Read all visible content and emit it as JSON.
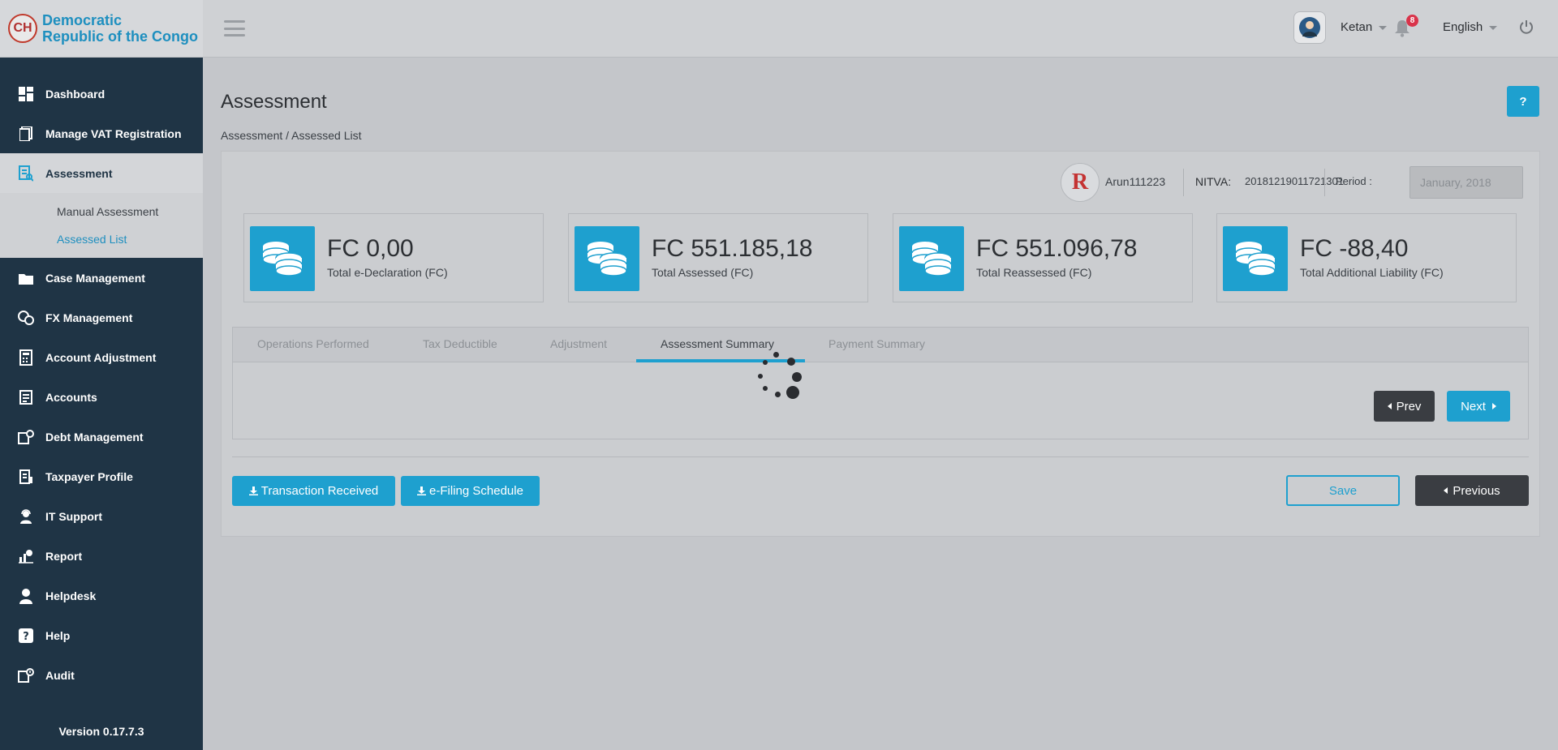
{
  "brand": {
    "name_line1": "Democratic",
    "name_line2": "Republic of the Congo",
    "logo_text": "CH"
  },
  "sidebar": {
    "items": [
      {
        "label": "Dashboard",
        "icon": "dashboard-icon"
      },
      {
        "label": "Manage VAT Registration",
        "icon": "vat-registration-icon"
      },
      {
        "label": "Assessment",
        "icon": "assessment-icon"
      },
      {
        "label": "Case Management",
        "icon": "case-management-icon"
      },
      {
        "label": "FX Management",
        "icon": "fx-management-icon"
      },
      {
        "label": "Account Adjustment",
        "icon": "account-adjustment-icon"
      },
      {
        "label": "Accounts",
        "icon": "accounts-icon"
      },
      {
        "label": "Debt Management",
        "icon": "debt-management-icon"
      },
      {
        "label": "Taxpayer Profile",
        "icon": "taxpayer-profile-icon"
      },
      {
        "label": "IT Support",
        "icon": "it-support-icon"
      },
      {
        "label": "Report",
        "icon": "report-icon"
      },
      {
        "label": "Helpdesk",
        "icon": "helpdesk-icon"
      },
      {
        "label": "Help",
        "icon": "help-icon"
      },
      {
        "label": "Audit",
        "icon": "audit-icon"
      }
    ],
    "submenu": [
      {
        "label": "Manual Assessment"
      },
      {
        "label": "Assessed List"
      }
    ],
    "version": "Version 0.17.7.3"
  },
  "header": {
    "username": "Ketan",
    "notification_count": "8",
    "language": "English"
  },
  "page": {
    "title": "Assessment",
    "help_label": "?",
    "breadcrumb": "Assessment / Assessed List"
  },
  "taxpayer": {
    "logo_text": "R",
    "name": "Arun111223",
    "nitva_label": "NITVA:",
    "nitva_value": "20181219011721301",
    "period_label": "Period :",
    "period_value": "January, 2018"
  },
  "stats": [
    {
      "value": "FC 0,00",
      "label": "Total e-Declaration (FC)"
    },
    {
      "value": "FC 551.185,18",
      "label": "Total Assessed (FC)"
    },
    {
      "value": "FC 551.096,78",
      "label": "Total Reassessed (FC)"
    },
    {
      "value": "FC -88,40",
      "label": "Total Additional Liability (FC)"
    }
  ],
  "tabs": [
    {
      "label": "Operations Performed"
    },
    {
      "label": "Tax Deductible"
    },
    {
      "label": "Adjustment"
    },
    {
      "label": "Assessment Summary"
    },
    {
      "label": "Payment Summary"
    }
  ],
  "tab_nav": {
    "prev": "Prev",
    "next": "Next"
  },
  "actions": {
    "transaction_received": "Transaction Received",
    "efiling_schedule": "e-Filing Schedule",
    "save": "Save",
    "previous": "Previous"
  },
  "colors": {
    "accent": "#1ea0cf",
    "sidebar_bg": "#1f3445",
    "dark_button": "#3a3d42"
  }
}
